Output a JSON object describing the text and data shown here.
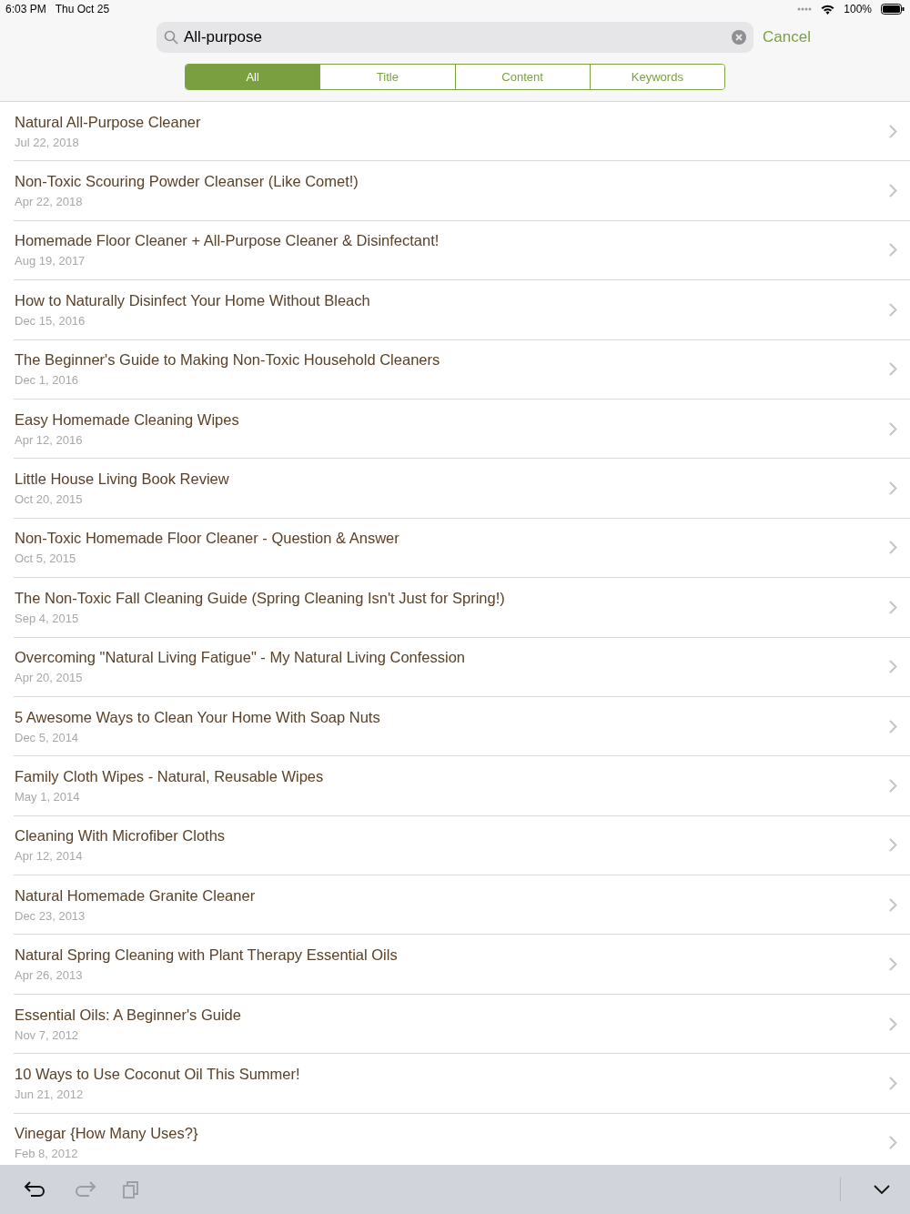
{
  "status_bar": {
    "time": "6:03 PM",
    "date": "Thu Oct 25",
    "battery": "100%"
  },
  "search": {
    "value": "All-purpose",
    "cancel": "Cancel"
  },
  "scopes": [
    {
      "label": "All",
      "selected": true
    },
    {
      "label": "Title",
      "selected": false
    },
    {
      "label": "Content",
      "selected": false
    },
    {
      "label": "Keywords",
      "selected": false
    }
  ],
  "results": [
    {
      "title": "Natural All-Purpose Cleaner",
      "date": "Jul 22, 2018"
    },
    {
      "title": "Non-Toxic Scouring Powder Cleanser (Like Comet!)",
      "date": "Apr 22, 2018"
    },
    {
      "title": "Homemade Floor Cleaner + All-Purpose Cleaner & Disinfectant!",
      "date": "Aug 19, 2017"
    },
    {
      "title": "How to Naturally Disinfect Your Home Without Bleach",
      "date": "Dec 15, 2016"
    },
    {
      "title": "The Beginner's Guide to Making Non-Toxic Household Cleaners",
      "date": "Dec 1, 2016"
    },
    {
      "title": "Easy Homemade Cleaning Wipes",
      "date": "Apr 12, 2016"
    },
    {
      "title": "Little House Living Book Review",
      "date": "Oct 20, 2015"
    },
    {
      "title": "Non-Toxic Homemade Floor Cleaner - Question & Answer",
      "date": "Oct 5, 2015"
    },
    {
      "title": "The Non-Toxic Fall Cleaning Guide (Spring Cleaning Isn't Just for Spring!)",
      "date": "Sep 4, 2015"
    },
    {
      "title": "Overcoming \"Natural Living Fatigue\" - My Natural Living Confession",
      "date": "Apr 20, 2015"
    },
    {
      "title": "5 Awesome Ways to Clean Your Home With Soap Nuts",
      "date": "Dec 5, 2014"
    },
    {
      "title": "Family Cloth Wipes - Natural, Reusable Wipes",
      "date": "May 1, 2014"
    },
    {
      "title": "Cleaning With Microfiber Cloths",
      "date": "Apr 12, 2014"
    },
    {
      "title": "Natural Homemade Granite Cleaner",
      "date": "Dec 23, 2013"
    },
    {
      "title": "Natural Spring Cleaning with Plant Therapy Essential Oils",
      "date": "Apr 26, 2013"
    },
    {
      "title": "Essential Oils: A Beginner's Guide",
      "date": "Nov 7, 2012"
    },
    {
      "title": "10 Ways to Use Coconut Oil This Summer!",
      "date": "Jun 21, 2012"
    },
    {
      "title": "Vinegar {How Many Uses?}",
      "date": "Feb 8, 2012"
    }
  ],
  "toolbar": [
    {
      "kind": "undo",
      "disabled": false
    },
    {
      "kind": "redo",
      "disabled": true
    },
    {
      "kind": "paste",
      "disabled": true
    }
  ]
}
